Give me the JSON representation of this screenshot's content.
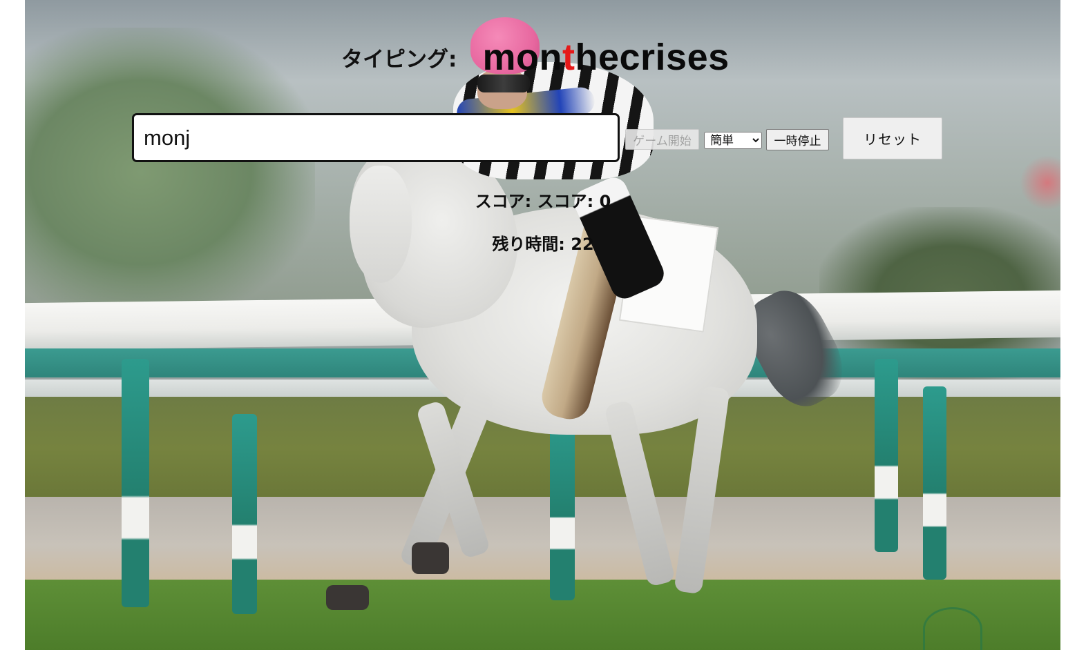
{
  "game": {
    "title_label": "タイピング:",
    "target_word": {
      "typed": "mon",
      "current": "t",
      "remaining": "hecrises"
    },
    "current_char_color": "#e51919"
  },
  "input": {
    "value": "monj",
    "placeholder": ""
  },
  "controls": {
    "start_label": "ゲーム開始",
    "difficulty": {
      "selected": "簡単"
    },
    "pause_label": "一時停止",
    "reset_label": "リセット"
  },
  "status": {
    "score_text": "スコア: スコア: 0",
    "time_text": "残り時間: 22"
  },
  "background": {
    "image_subject": "white-racehorse-with-jockey",
    "accent_colors": {
      "rail_teal": "#2f857b",
      "helmet_pink": "#e7679f"
    }
  }
}
